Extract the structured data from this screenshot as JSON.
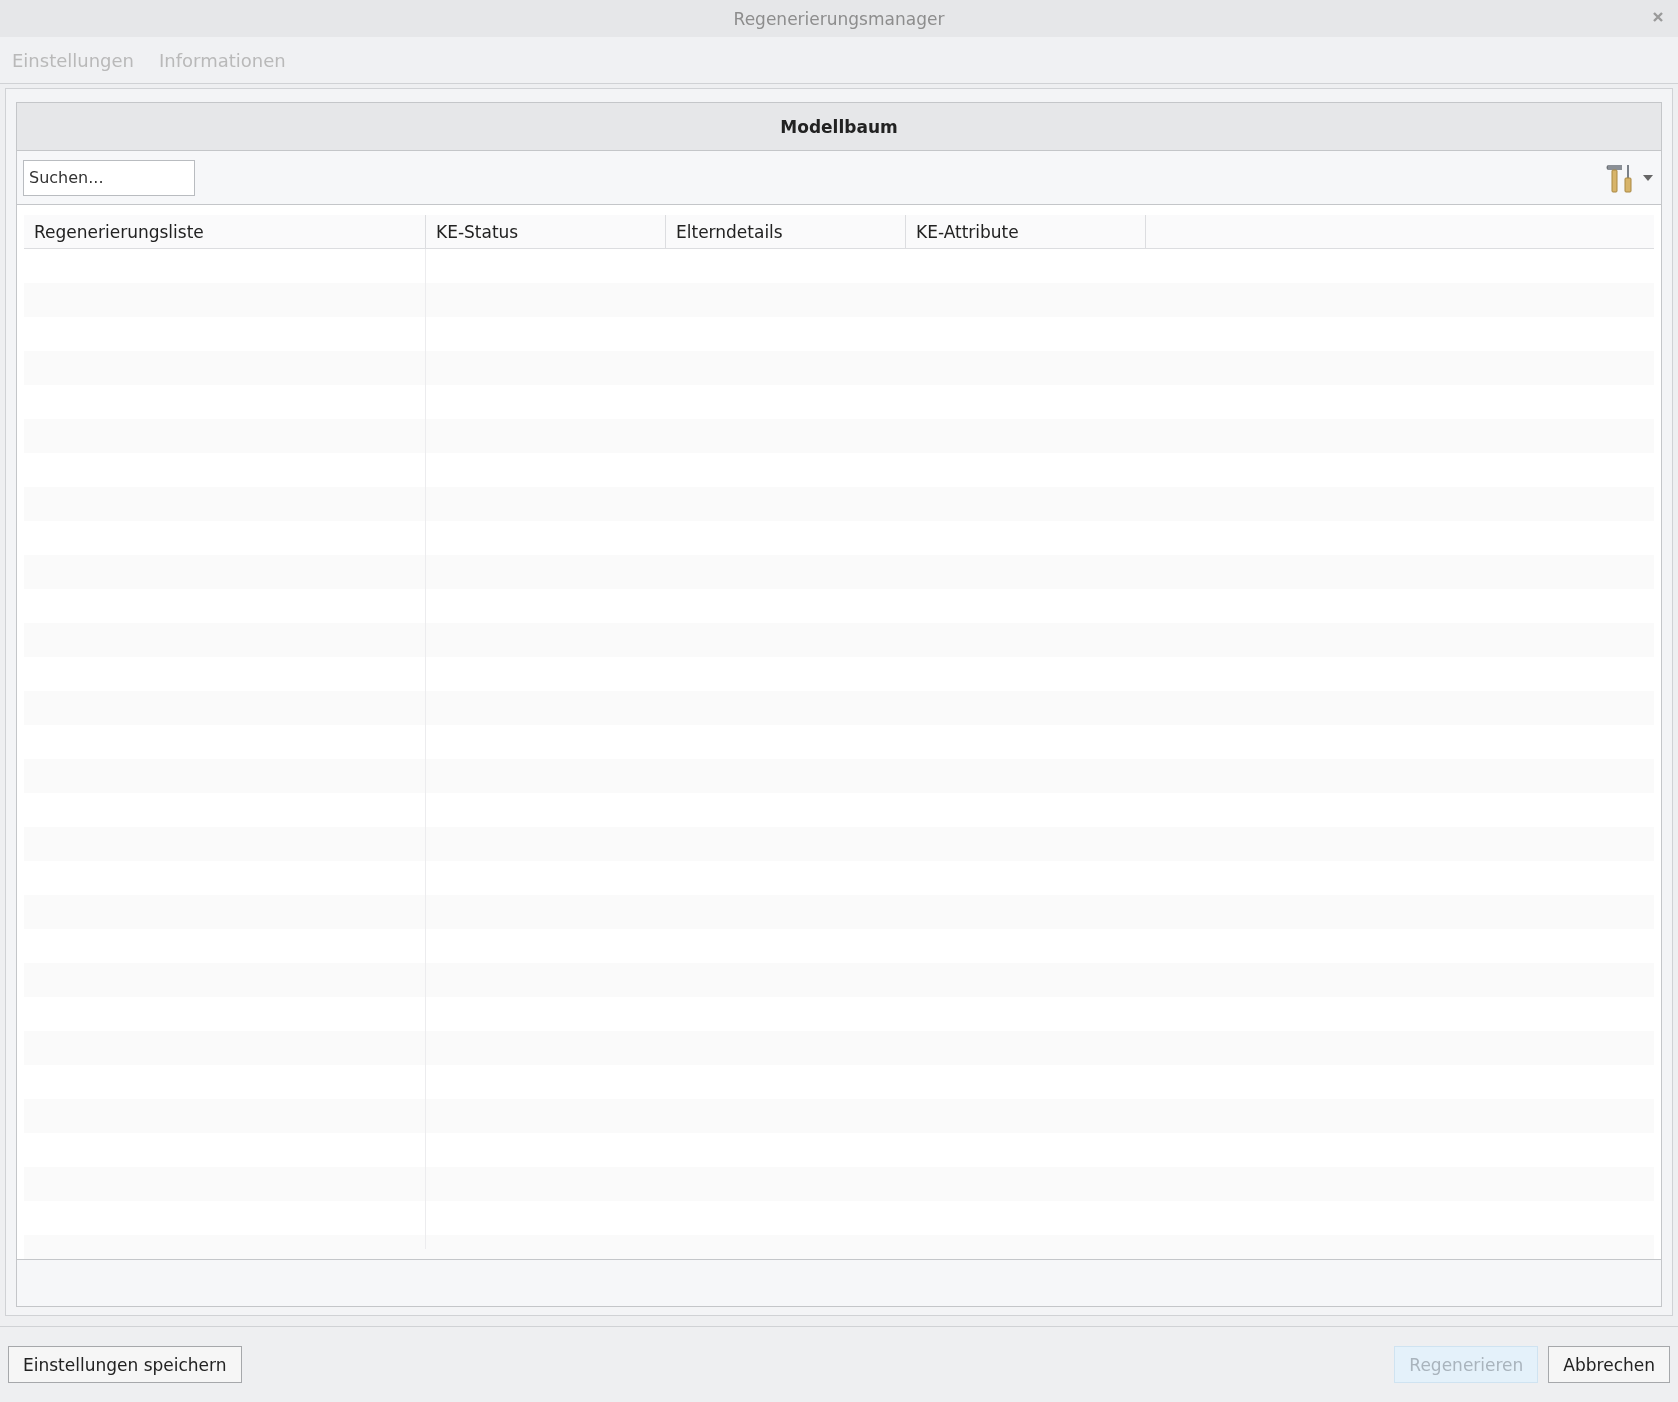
{
  "window": {
    "title": "Regenerierungsmanager"
  },
  "menu": [
    {
      "label": "Einstellungen",
      "disabled": true
    },
    {
      "label": "Informationen",
      "disabled": true
    }
  ],
  "panel": {
    "title": "Modellbaum",
    "search": {
      "placeholder": "Suchen..."
    }
  },
  "table": {
    "columns": [
      "Regenerierungsliste",
      "KE-Status",
      "Elterndetails",
      "KE-Attribute"
    ]
  },
  "left_buttons": [
    {
      "label": "Einstellungen speichern",
      "disabled": false
    }
  ],
  "right_buttons": [
    {
      "label": "Regenerieren",
      "disabled": true
    },
    {
      "label": "Abbrechen",
      "disabled": false
    }
  ]
}
